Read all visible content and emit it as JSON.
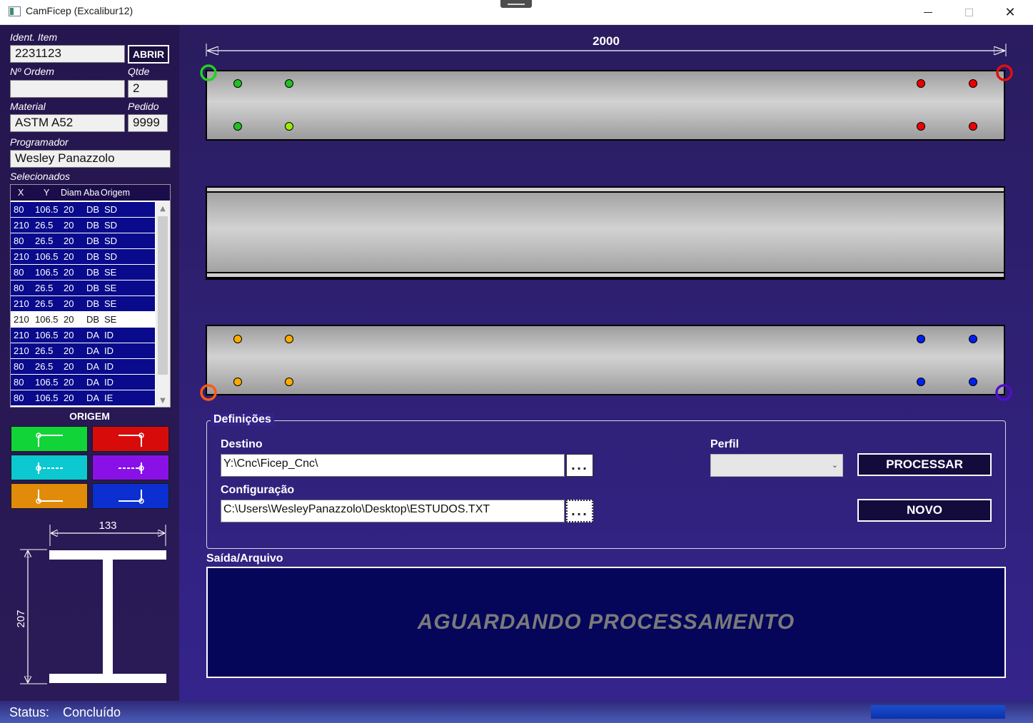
{
  "window": {
    "title": "CamFicep (Excalibur12)",
    "minimize": "",
    "maximize": "",
    "close": "✕"
  },
  "sidebar": {
    "ident_label": "Ident. Item",
    "ident_value": "2231123",
    "abrir_label": "ABRIR",
    "ordem_label": "Nº Ordem",
    "ordem_value": "",
    "qtde_label": "Qtde",
    "qtde_value": "2",
    "material_label": "Material",
    "material_value": "ASTM A52",
    "pedido_label": "Pedido",
    "pedido_value": "9999",
    "programador_label": "Programador",
    "programador_value": "Wesley Panazzolo",
    "selecionados_label": "Selecionados",
    "columns": [
      "X",
      "Y",
      "Diam",
      "Aba",
      "Origem"
    ],
    "rows": [
      {
        "x": "80",
        "y": "106.5",
        "diam": "20",
        "aba": "DB",
        "origem": "SD"
      },
      {
        "x": "210",
        "y": "26.5",
        "diam": "20",
        "aba": "DB",
        "origem": "SD"
      },
      {
        "x": "80",
        "y": "26.5",
        "diam": "20",
        "aba": "DB",
        "origem": "SD"
      },
      {
        "x": "210",
        "y": "106.5",
        "diam": "20",
        "aba": "DB",
        "origem": "SD"
      },
      {
        "x": "80",
        "y": "106.5",
        "diam": "20",
        "aba": "DB",
        "origem": "SE"
      },
      {
        "x": "80",
        "y": "26.5",
        "diam": "20",
        "aba": "DB",
        "origem": "SE"
      },
      {
        "x": "210",
        "y": "26.5",
        "diam": "20",
        "aba": "DB",
        "origem": "SE"
      },
      {
        "x": "210",
        "y": "106.5",
        "diam": "20",
        "aba": "DB",
        "origem": "SE"
      },
      {
        "x": "210",
        "y": "106.5",
        "diam": "20",
        "aba": "DA",
        "origem": "ID"
      },
      {
        "x": "210",
        "y": "26.5",
        "diam": "20",
        "aba": "DA",
        "origem": "ID"
      },
      {
        "x": "80",
        "y": "26.5",
        "diam": "20",
        "aba": "DA",
        "origem": "ID"
      },
      {
        "x": "80",
        "y": "106.5",
        "diam": "20",
        "aba": "DA",
        "origem": "ID"
      },
      {
        "x": "80",
        "y": "106.5",
        "diam": "20",
        "aba": "DA",
        "origem": "IE"
      }
    ],
    "selected_row": 7,
    "origem_title": "ORIGEM",
    "origem_buttons": [
      {
        "name": "top-left",
        "color": "#11d438"
      },
      {
        "name": "top-right",
        "color": "#d80b0b"
      },
      {
        "name": "middle-left",
        "color": "#0cc8d0"
      },
      {
        "name": "middle-right",
        "color": "#8a10e8"
      },
      {
        "name": "bottom-left",
        "color": "#e08c0a"
      },
      {
        "name": "bottom-right",
        "color": "#0b2fd0"
      }
    ],
    "profile_width": "133",
    "profile_height": "207"
  },
  "main": {
    "beam_length": "2000",
    "top_holes_green": [
      [
        0,
        0
      ],
      [
        1,
        0
      ],
      [
        0,
        1
      ]
    ],
    "definicoes_label": "Definições",
    "destino_label": "Destino",
    "destino_value": "Y:\\Cnc\\Ficep_Cnc\\",
    "browse_label": "...",
    "configuracao_label": "Configuração",
    "configuracao_value": "C:\\Users\\WesleyPanazzolo\\Desktop\\ESTUDOS.TXT",
    "perfil_label": "Perfil",
    "perfil_value": "",
    "processar_label": "PROCESSAR",
    "novo_label": "NOVO",
    "saida_label": "Saída/Arquivo",
    "output_text": "AGUARDANDO PROCESSAMENTO"
  },
  "status": {
    "label": "Status:",
    "value": "Concluído",
    "progress": 1.0
  },
  "colors": {
    "sidebar_bg": "#25164f",
    "main_bg": "#34248c",
    "output_bg": "#05065a",
    "row_bg": "#0a0a8c",
    "hole_green": "#22cc22",
    "hole_lime": "#99ee00",
    "hole_red": "#ee0000",
    "hole_orange": "#ffaa00",
    "hole_blue": "#0020ee"
  }
}
